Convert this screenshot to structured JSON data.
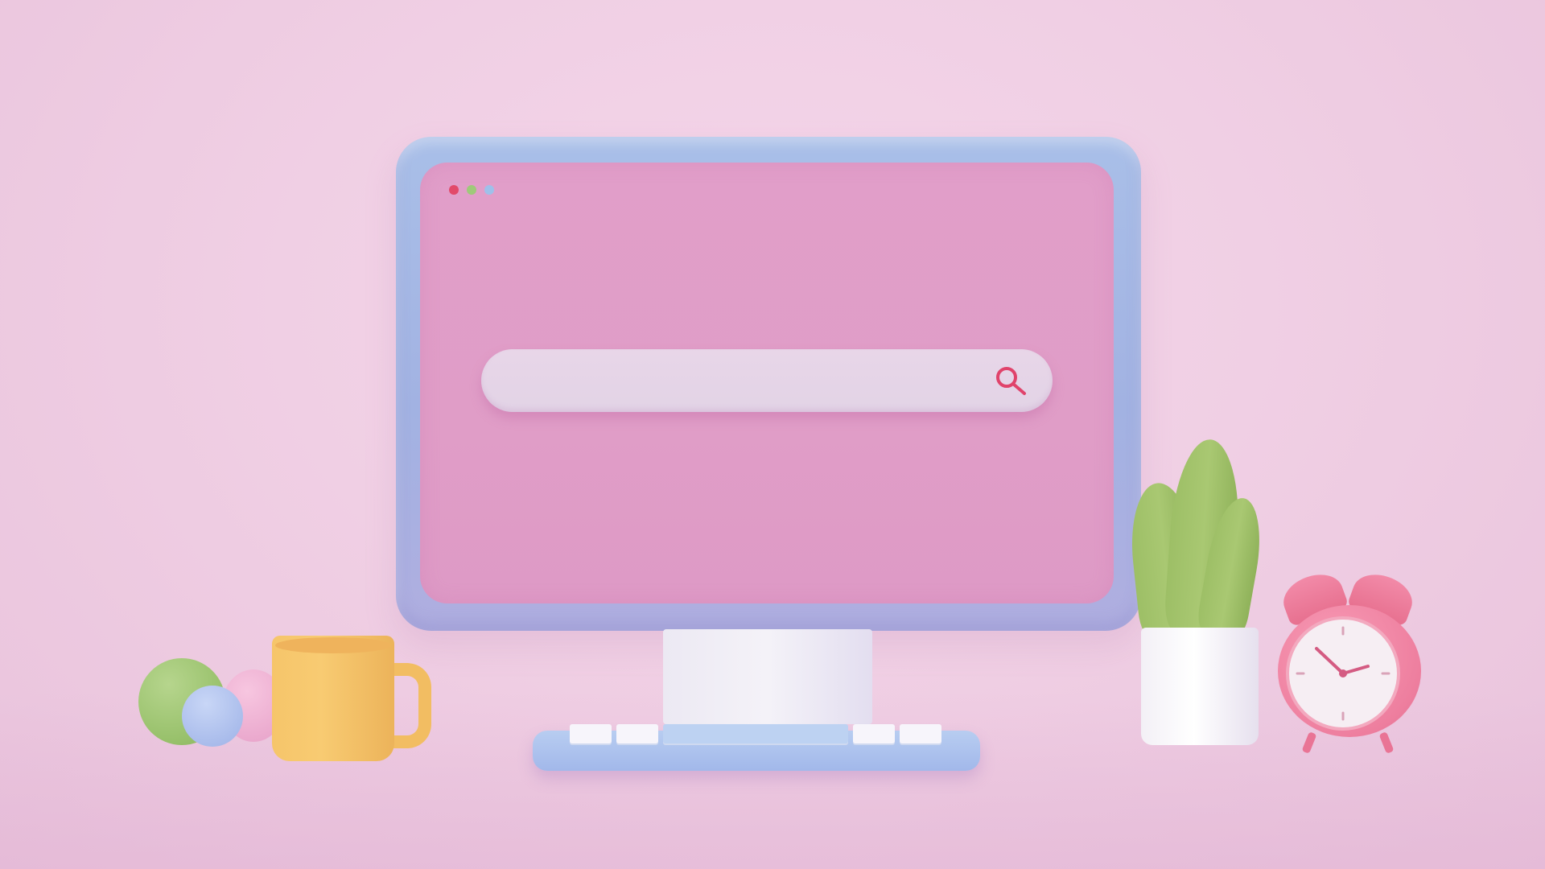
{
  "scene": {
    "background_color": "#f2d2e6"
  },
  "monitor": {
    "frame_color": "#a6b8e6",
    "screen_color": "#e09dc7",
    "window_dots": [
      {
        "name": "close",
        "color": "#e24a6a"
      },
      {
        "name": "minimize",
        "color": "#9fc97a"
      },
      {
        "name": "maximize",
        "color": "#9fc0ea"
      }
    ],
    "search": {
      "value": "",
      "placeholder": "",
      "icon": "search-icon"
    }
  },
  "desk_items": {
    "mug_color": "#f6c56a",
    "ball_colors": [
      "#97c06a",
      "#eaa8cd",
      "#a6b9ea"
    ],
    "plant_color": "#9dbf66",
    "clock_color": "#ee7f9f",
    "clock_time": "10:10"
  }
}
